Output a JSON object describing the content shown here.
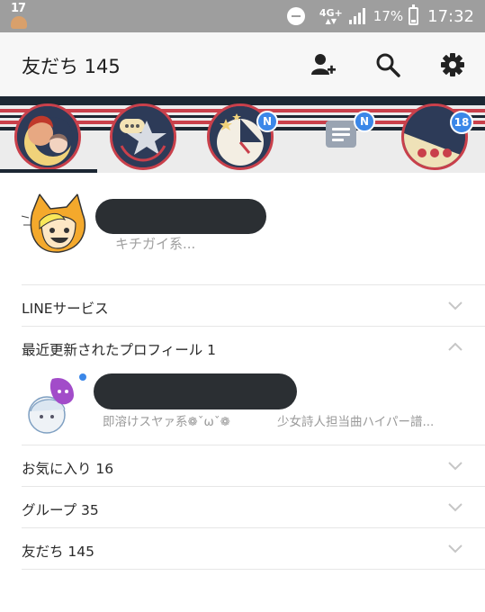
{
  "status_bar": {
    "notification_text": "17",
    "network": "4G+",
    "battery_percent": "17%",
    "time": "17:32",
    "icons": [
      "dnd-icon",
      "signal-icon",
      "battery-icon"
    ]
  },
  "header": {
    "title": "友だち 145",
    "actions": [
      "add-friend-icon",
      "search-icon",
      "settings-icon"
    ]
  },
  "tabs": {
    "badges": [
      "N",
      "N",
      "18"
    ],
    "selected_index": 0
  },
  "my_profile": {
    "status_message": "キチガイ系..."
  },
  "sections": {
    "line_services": "LINEサービス",
    "recently_updated": "最近更新されたプロフィール 1",
    "favorites": "お気に入り 16",
    "groups": "グループ 35",
    "friends": "友だち 145"
  },
  "updated_profile": {
    "status_message": "即溶けスヤァ系❁ˇωˇ❁",
    "music": "少女詩人担当曲ハイパー譜..."
  },
  "colors": {
    "accent_blue": "#3b87e8",
    "header_bg": "#f7f7f7",
    "status_bar_bg": "#9e9e9e",
    "banner_navy": "#1c2733",
    "banner_red": "#c9404b"
  }
}
